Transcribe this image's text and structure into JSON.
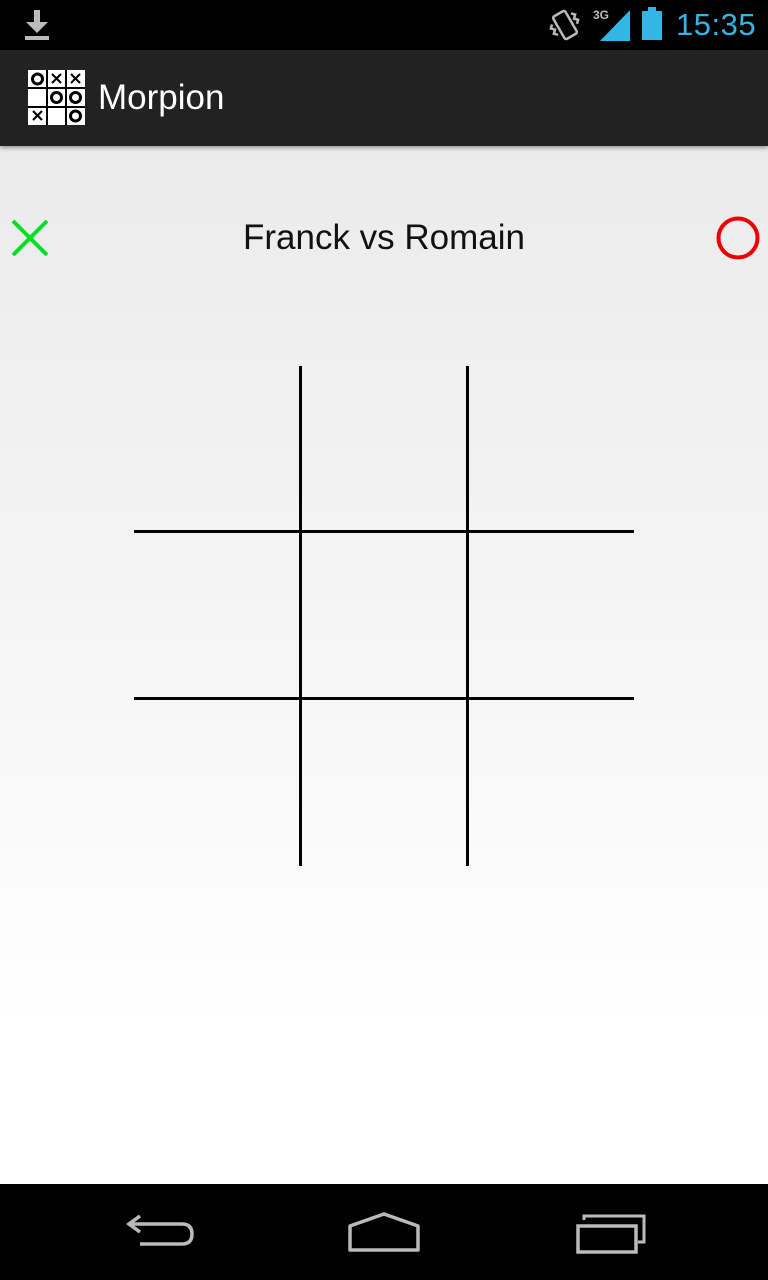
{
  "status_bar": {
    "time": "15:35",
    "network": "3G",
    "icons": [
      "download-icon",
      "vibrate-icon",
      "signal-icon",
      "battery-icon"
    ],
    "accent_color": "#33b5e5"
  },
  "action_bar": {
    "title": "Morpion",
    "icon": "tic-tac-toe-app-icon"
  },
  "game": {
    "title": "Franck vs Romain",
    "player_x": {
      "symbol": "X",
      "color": "#00e020"
    },
    "player_o": {
      "symbol": "O",
      "color": "#ee0000"
    },
    "board": [
      [
        "",
        "",
        ""
      ],
      [
        "",
        "",
        ""
      ],
      [
        "",
        "",
        ""
      ]
    ]
  },
  "nav_bar": {
    "buttons": [
      "back-icon",
      "home-icon",
      "recents-icon"
    ]
  }
}
